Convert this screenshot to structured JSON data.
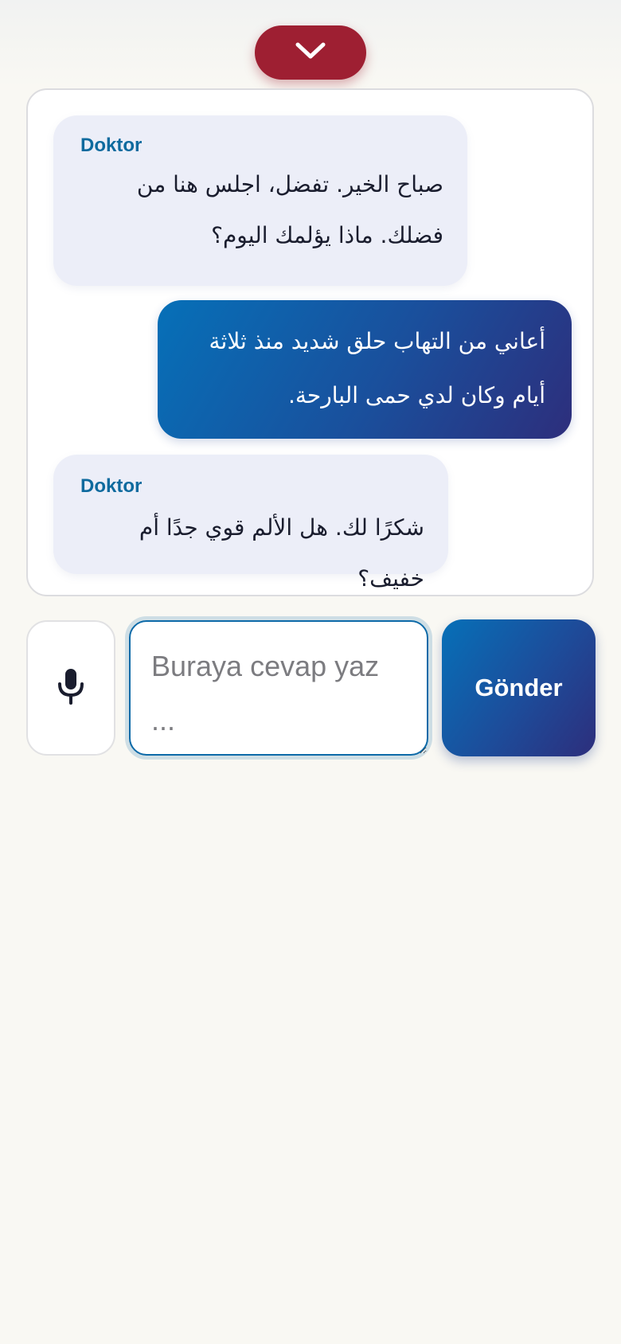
{
  "colors": {
    "page_background": "#f9f8f3",
    "collapse_button": "#9e1f32",
    "doctor_bubble": "#eceef8",
    "doctor_name": "#0e6a9e",
    "patient_bubble_gradient": [
      "#0670b8",
      "#2d2e7c"
    ],
    "send_button_gradient": [
      "#0670b8",
      "#2d2e7c"
    ],
    "input_focus_border": "#0d6aa8"
  },
  "header": {
    "collapse_icon": "chevron-down-icon"
  },
  "chat": {
    "messages": [
      {
        "role": "doctor",
        "sender": "Doktor",
        "line1": "صباح الخير. تفضل، اجلس هنا من",
        "line2": "فضلك. ماذا يؤلمك اليوم؟"
      },
      {
        "role": "patient",
        "line1": "أعاني من التهاب حلق شديد منذ ثلاثة",
        "line2": "أيام وكان لدي حمى البارحة."
      },
      {
        "role": "doctor",
        "sender": "Doktor",
        "line1": "شكرًا لك. هل الألم قوي جدًا أم خفيف؟"
      }
    ]
  },
  "composer": {
    "mic_icon": "microphone-icon",
    "input_placeholder": "Buraya cevap yaz ...",
    "input_value": "",
    "send_label": "Gönder"
  }
}
